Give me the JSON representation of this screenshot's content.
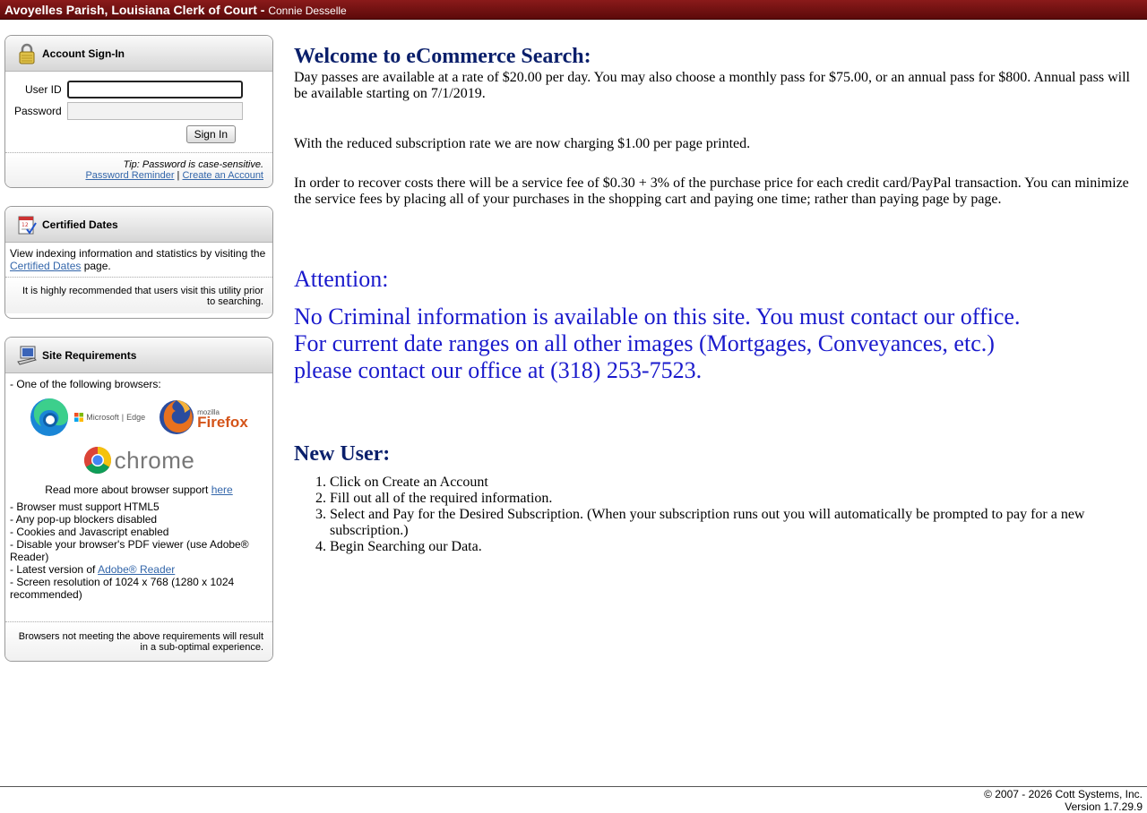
{
  "header": {
    "title": "Avoyelles Parish, Louisiana Clerk of Court - ",
    "clerk_name": "Connie Desselle"
  },
  "signin": {
    "title": "Account Sign-In",
    "icon": "padlock-icon",
    "userid_label": "User ID",
    "password_label": "Password",
    "userid_value": "",
    "password_value": "",
    "signin_button": "Sign In",
    "tip": "Tip: Password is case-sensitive.",
    "reminder_link": "Password Reminder",
    "separator": " | ",
    "create_link": "Create an Account"
  },
  "certified": {
    "title": "Certified Dates",
    "icon": "calendar-check-icon",
    "text_before": "View indexing information and statistics by visiting the ",
    "link": "Certified Dates",
    "text_after": " page.",
    "footer": "It is highly recommended that users visit this utility prior to searching."
  },
  "requirements": {
    "title": "Site Requirements",
    "icon": "computer-icon",
    "intro": "- One of the following browsers:",
    "browsers": {
      "edge_brand": "Microsoft",
      "edge_name": "Edge",
      "firefox_brand": "mozilla",
      "firefox_name": "Firefox",
      "chrome_name": "chrome"
    },
    "support_text": "Read more about browser support ",
    "support_link": "here",
    "items": [
      "- Browser must support HTML5",
      "- Any pop-up blockers disabled",
      "- Cookies and Javascript enabled",
      "- Disable your browser's PDF viewer (use Adobe® Reader)"
    ],
    "latest_prefix": "- Latest version of ",
    "latest_link": "Adobe® Reader",
    "resolution": "- Screen resolution of 1024 x 768 (1280 x 1024 recommended)",
    "footer": "Browsers not meeting the above requirements will result in a sub-optimal experience."
  },
  "main": {
    "heading": "Welcome to eCommerce Search:",
    "para1": "Day passes are available at a rate of $20.00 per day. You may also choose a monthly pass for $75.00, or an annual pass for $800. Annual pass will be available starting on 7/1/2019.",
    "para2": "With the reduced subscription rate we are now charging $1.00 per page printed.",
    "para3": "In order to recover costs there will be a service fee of $0.30 + 3% of the purchase price for each credit card/PayPal transaction.  You can minimize the service fees by placing all of your purchases in the shopping cart and paying one time; rather than paying page by page.",
    "attention": "Attention:",
    "notice1": "No Criminal information is available on this site. You must contact our office.",
    "notice2": "For current date ranges on all other images (Mortgages, Conveyances, etc.)",
    "notice3": "please contact our office at (318) 253-7523.",
    "new_user_heading": "New User:",
    "steps": [
      "Click on Create an Account",
      "Fill out all of the required information.",
      "Select and Pay for the Desired Subscription. (When your subscription runs out you will automatically be prompted to pay for a new subscription.)",
      "Begin Searching our Data."
    ]
  },
  "footer": {
    "copyright": "© 2007 - 2026 Cott Systems, Inc.",
    "version": "Version 1.7.29.9"
  }
}
